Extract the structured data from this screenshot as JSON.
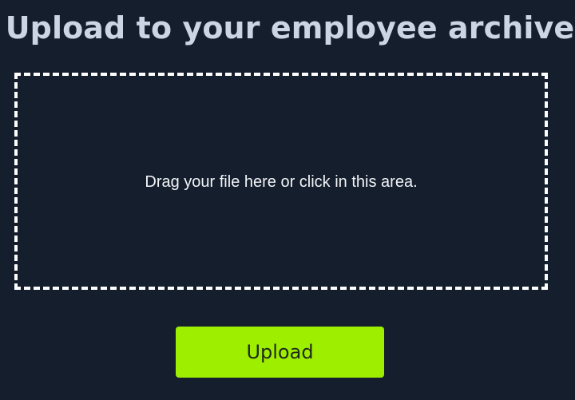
{
  "page": {
    "title": "Upload to your employee archive"
  },
  "drop_zone": {
    "text": "Drag your file here or click in this area."
  },
  "actions": {
    "upload_label": "Upload"
  },
  "colors": {
    "background": "#141e2d",
    "title": "#cbd5e4",
    "drop_zone_border": "#ffffff",
    "button_background": "#9eee00"
  }
}
